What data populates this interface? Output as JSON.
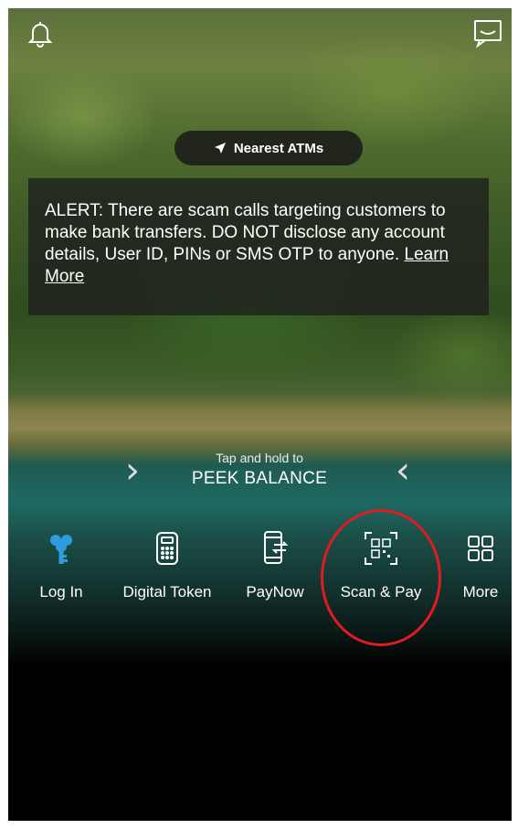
{
  "pill": {
    "label": "Nearest ATMs",
    "icon": "location-arrow-icon"
  },
  "alert": {
    "text": "ALERT: There are scam calls targeting customers to make bank transfers. DO NOT disclose any account details, User ID, PINs or SMS OTP to anyone.",
    "link": "Learn More"
  },
  "peek": {
    "hint": "Tap and hold to",
    "label": "PEEK BALANCE"
  },
  "actions": [
    {
      "label": "Log In",
      "icon": "key-icon"
    },
    {
      "label": "Digital Token",
      "icon": "token-device-icon"
    },
    {
      "label": "PayNow",
      "icon": "phone-transfer-icon"
    },
    {
      "label": "Scan & Pay",
      "icon": "qr-scan-icon"
    },
    {
      "label": "More",
      "icon": "grid-icon"
    }
  ],
  "colors": {
    "highlight_circle": "#e11b22",
    "login_icon": "#2f9be0"
  }
}
